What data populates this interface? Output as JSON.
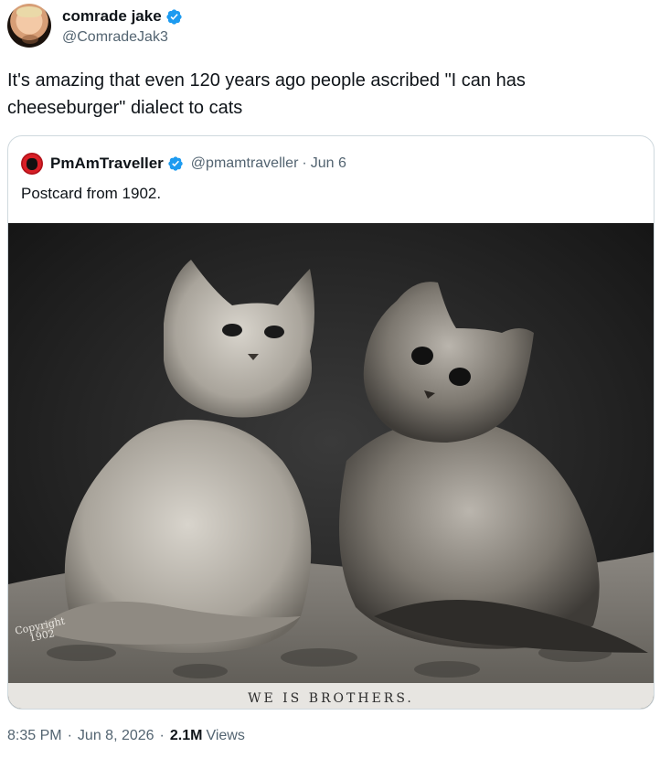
{
  "author": {
    "name": "comrade jake",
    "handle": "@ComradeJak3"
  },
  "tweet": {
    "text": "It's amazing that even 120 years ago people ascribed \"I can has cheeseburger\" dialect to cats"
  },
  "quote": {
    "name": "PmAmTraveller",
    "handle": "@pmamtraveller",
    "separator": "·",
    "date": "Jun 6",
    "text": "Postcard from 1902.",
    "image": {
      "caption": "WE IS BROTHERS.",
      "copyright_line1": "Copyright",
      "copyright_line2": "1902"
    }
  },
  "meta": {
    "time": "8:35 PM",
    "dot1": "·",
    "date": "Jun 8, 2026",
    "dot2": "·",
    "views_count": "2.1M",
    "views_label": "Views"
  },
  "colors": {
    "verified": "#1d9bf0",
    "secondary_text": "#536471",
    "border": "#cfd9de"
  }
}
